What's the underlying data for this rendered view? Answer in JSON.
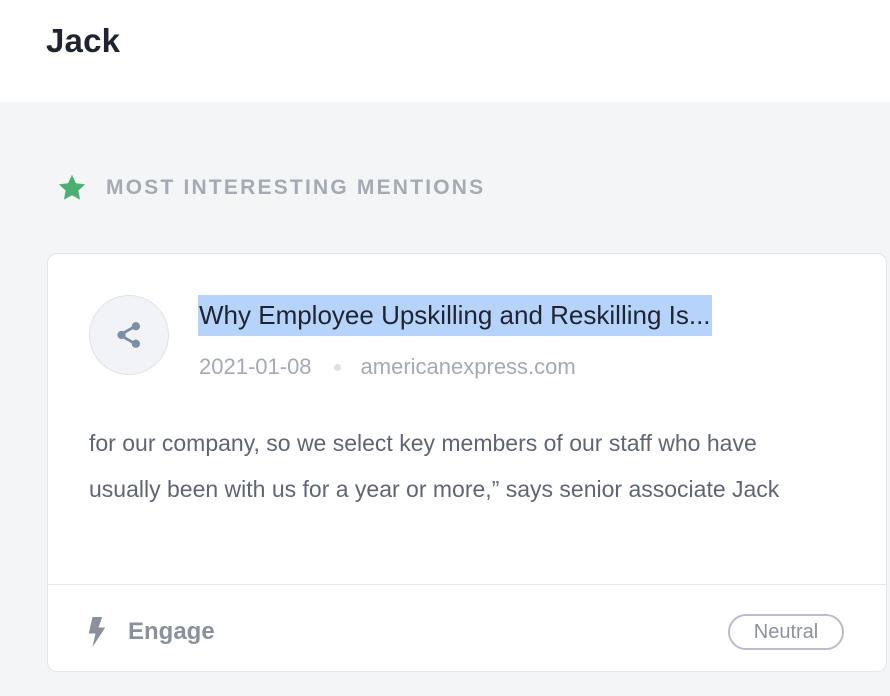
{
  "header": {
    "title": "Jack"
  },
  "section": {
    "title": "MOST INTERESTING MENTIONS",
    "icon": "star-icon",
    "icon_color": "#4caf72"
  },
  "mention": {
    "source_icon": "share-icon",
    "title": "Why Employee Upskilling and Reskilling Is...",
    "date": "2021-01-08",
    "source": "americanexpress.com",
    "excerpt": "for our company, so we select key members of our staff who have usually been with us for a year or more,” says senior associate Jack",
    "action": {
      "label": "Engage",
      "icon": "lightning-icon"
    },
    "sentiment": "Neutral"
  },
  "colors": {
    "highlight": "#b5d3fb",
    "muted_text": "#a4abb5",
    "page_background": "#f4f5f7"
  }
}
